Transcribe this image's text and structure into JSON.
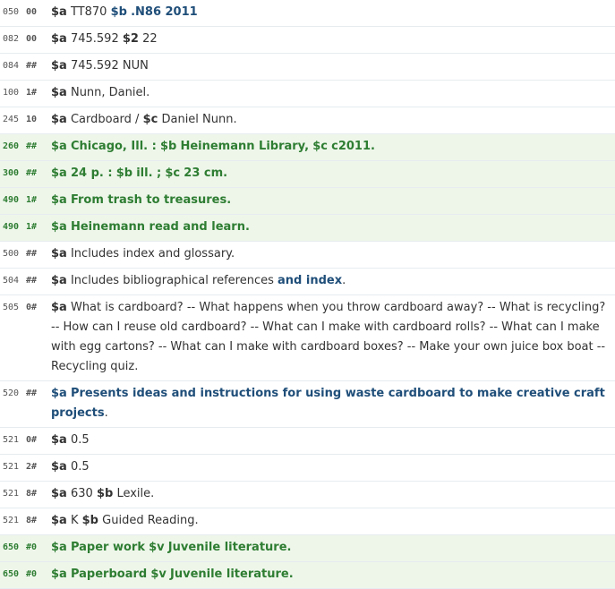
{
  "rows": [
    {
      "tag": "050",
      "ind": "00",
      "green": false,
      "segments": [
        {
          "code": "$a",
          "text": "TT870"
        },
        {
          "code": "$b",
          "text": ".N86 2011",
          "emph": true
        }
      ]
    },
    {
      "tag": "082",
      "ind": "00",
      "green": false,
      "segments": [
        {
          "code": "$a",
          "text": "745.592"
        },
        {
          "code": "$2",
          "text": "22"
        }
      ]
    },
    {
      "tag": "084",
      "ind": "##",
      "green": false,
      "segments": [
        {
          "code": "$a",
          "text": "745.592 NUN"
        }
      ]
    },
    {
      "tag": "100",
      "ind": "1#",
      "green": false,
      "segments": [
        {
          "code": "$a",
          "text": "Nunn, Daniel."
        }
      ]
    },
    {
      "tag": "245",
      "ind": "10",
      "green": false,
      "segments": [
        {
          "code": "$a",
          "text": "Cardboard /"
        },
        {
          "code": "$c",
          "text": "Daniel Nunn."
        }
      ]
    },
    {
      "tag": "260",
      "ind": "##",
      "green": true,
      "segments": [
        {
          "code": "$a",
          "text": "Chicago, Ill. :"
        },
        {
          "code": "$b",
          "text": "Heinemann Library,"
        },
        {
          "code": "$c",
          "text": "c2011."
        }
      ]
    },
    {
      "tag": "300",
      "ind": "##",
      "green": true,
      "segments": [
        {
          "code": "$a",
          "text": "24 p. :"
        },
        {
          "code": "$b",
          "text": "ill. ;"
        },
        {
          "code": "$c",
          "text": "23 cm."
        }
      ]
    },
    {
      "tag": "490",
      "ind": "1#",
      "green": true,
      "segments": [
        {
          "code": "$a",
          "text": "From trash to treasures."
        }
      ]
    },
    {
      "tag": "490",
      "ind": "1#",
      "green": true,
      "segments": [
        {
          "code": "$a",
          "text": "Heinemann read and learn."
        }
      ]
    },
    {
      "tag": "500",
      "ind": "##",
      "green": false,
      "segments": [
        {
          "code": "$a",
          "text": "Includes index and glossary."
        }
      ]
    },
    {
      "tag": "504",
      "ind": "##",
      "green": false,
      "segments": [
        {
          "code": "$a",
          "text": "Includes bibliographical references"
        },
        {
          "code": "",
          "text": "and index",
          "emph": true
        },
        {
          "code": "",
          "text": "."
        }
      ]
    },
    {
      "tag": "505",
      "ind": "0#",
      "green": false,
      "segments": [
        {
          "code": "$a",
          "text": "What is cardboard? -- What happens when you throw cardboard away? -- What is recycling? -- How can I reuse old cardboard? -- What can I make with cardboard rolls? -- What can I make with egg cartons? -- What can I make with cardboard boxes? -- Make your own juice box boat -- Recycling quiz."
        }
      ]
    },
    {
      "tag": "520",
      "ind": "##",
      "green": false,
      "segments": [
        {
          "code": "$a",
          "text": "Presents ideas and instructions for using waste cardboard to make creative craft projects",
          "emph": true
        },
        {
          "code": "",
          "text": "."
        }
      ]
    },
    {
      "tag": "521",
      "ind": "0#",
      "green": false,
      "segments": [
        {
          "code": "$a",
          "text": "0.5"
        }
      ]
    },
    {
      "tag": "521",
      "ind": "2#",
      "green": false,
      "segments": [
        {
          "code": "$a",
          "text": "0.5"
        }
      ]
    },
    {
      "tag": "521",
      "ind": "8#",
      "green": false,
      "segments": [
        {
          "code": "$a",
          "text": "630"
        },
        {
          "code": "$b",
          "text": "Lexile."
        }
      ]
    },
    {
      "tag": "521",
      "ind": "8#",
      "green": false,
      "segments": [
        {
          "code": "$a",
          "text": "K"
        },
        {
          "code": "$b",
          "text": "Guided Reading."
        }
      ]
    },
    {
      "tag": "650",
      "ind": "#0",
      "green": true,
      "segments": [
        {
          "code": "$a",
          "text": "Paper work"
        },
        {
          "code": "$v",
          "text": "Juvenile literature."
        }
      ]
    },
    {
      "tag": "650",
      "ind": "#0",
      "green": true,
      "segments": [
        {
          "code": "$a",
          "text": "Paperboard"
        },
        {
          "code": "$v",
          "text": "Juvenile literature."
        }
      ]
    }
  ]
}
